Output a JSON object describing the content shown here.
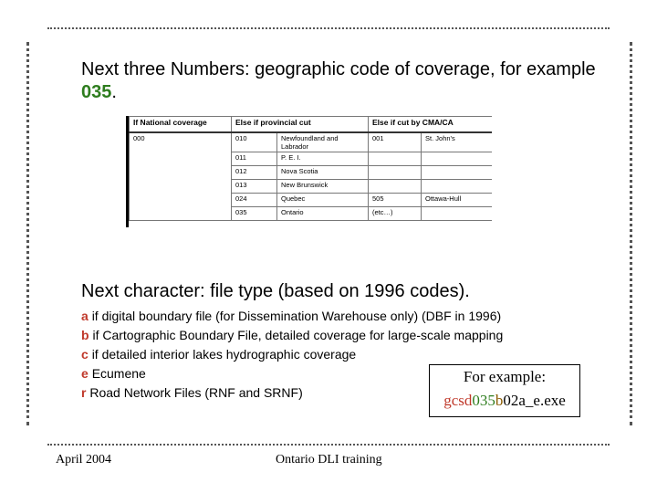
{
  "heading1": {
    "text": "Next three Numbers: geographic code of coverage, for example",
    "code": "035",
    "end": "."
  },
  "table": {
    "headers": [
      "If National coverage",
      "Else if provincial cut",
      "Else if cut by CMA/CA"
    ],
    "rows": [
      [
        "000",
        "010",
        "Newfoundland and Labrador",
        "001",
        "St. John's"
      ],
      [
        "",
        "011",
        "P. E. I.",
        "",
        ""
      ],
      [
        "",
        "012",
        "Nova Scotia",
        "",
        ""
      ],
      [
        "",
        "013",
        "New Brunswick",
        "",
        ""
      ],
      [
        "",
        "024",
        "Quebec",
        "505",
        "Ottawa-Hull"
      ],
      [
        "",
        "035",
        "Ontario",
        "(etc…)",
        ""
      ]
    ]
  },
  "heading2": "Next character: file type (based on 1996 codes).",
  "file_types": [
    {
      "letter": "a",
      "text": "if digital boundary file (for Dissemination Warehouse only) (DBF in 1996)"
    },
    {
      "letter": "b",
      "text": "if Cartographic Boundary File, detailed coverage for large-scale mapping"
    },
    {
      "letter": "c",
      "text": "if detailed interior lakes hydrographic coverage"
    },
    {
      "letter": "e",
      "text": "Ecumene"
    },
    {
      "letter": "r",
      "text": "Road Network Files (RNF and SRNF)"
    }
  ],
  "example": {
    "label": "For example:",
    "parts": {
      "prefix": "gcsd",
      "code": "035",
      "type": "b",
      "rest": "02a_e.exe"
    }
  },
  "footer": {
    "date": "April 2004",
    "title": "Ontario DLI training"
  },
  "colors": {
    "green": "#2e7d1e",
    "red": "#c0392b",
    "brown": "#8a5a00"
  }
}
